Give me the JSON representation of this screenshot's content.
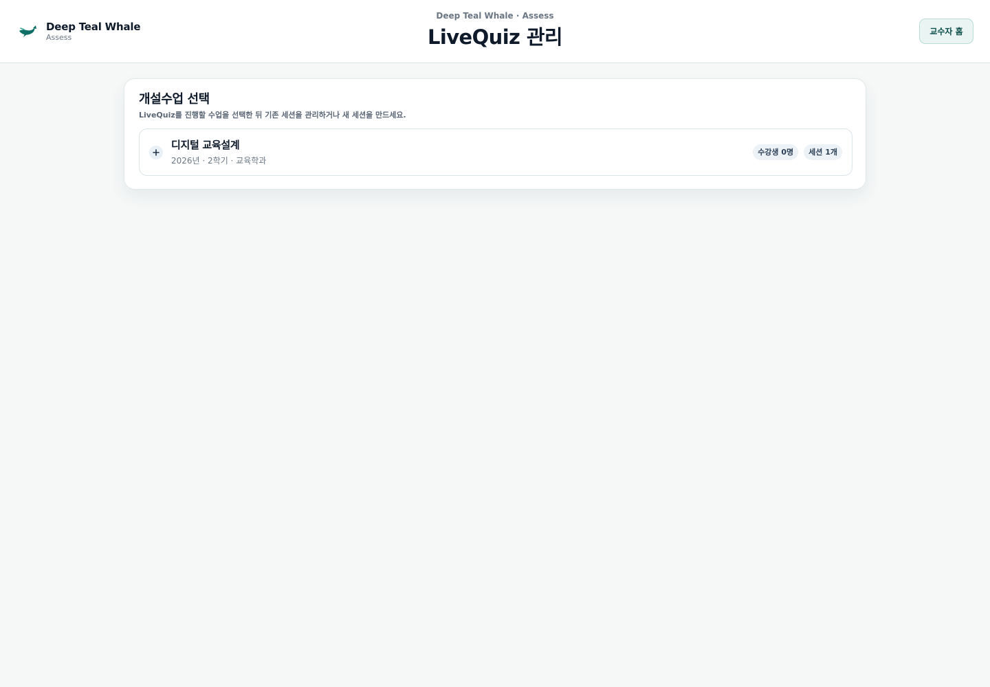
{
  "header": {
    "brand_name": "Deep Teal Whale",
    "brand_sub": "Assess",
    "eyebrow": "Deep Teal Whale · Assess",
    "title": "LiveQuiz 관리",
    "home_button": "교수자 홈"
  },
  "section": {
    "title": "개설수업 선택",
    "description": "LiveQuiz를 진행할 수업을 선택한 뒤 기존 세션을 관리하거나 새 세션을 만드세요."
  },
  "courses": [
    {
      "name": "디지털 교육설계",
      "meta": "2026년 · 2학기 · 교육학과",
      "students_badge": "수강생 0명",
      "sessions_badge": "세션 1개"
    }
  ],
  "colors": {
    "accent": "#0f6e66",
    "background": "#f6f8f8"
  },
  "icons": {
    "brand": "whale-icon",
    "expand": "plus-icon"
  }
}
